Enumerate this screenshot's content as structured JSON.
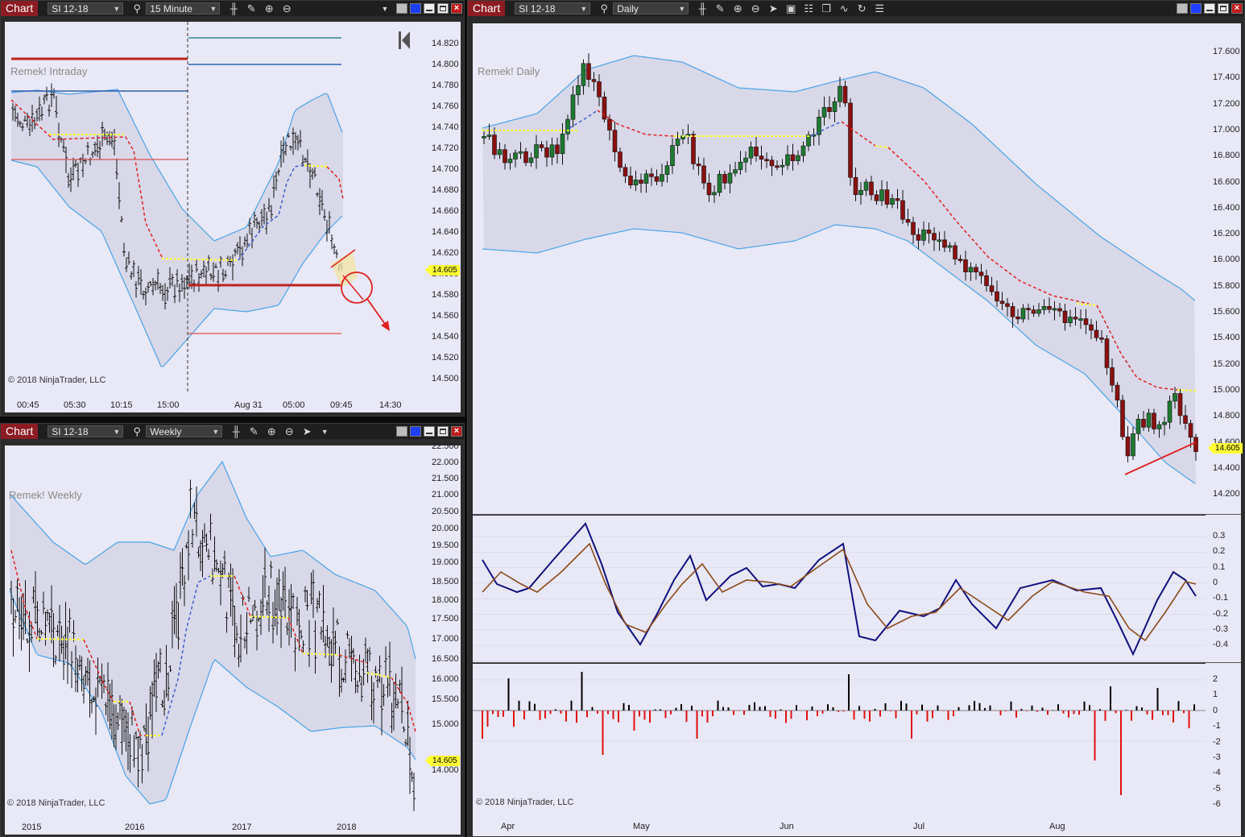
{
  "windows": {
    "intraday": {
      "tab": "Chart",
      "instrument": "SI 12-18",
      "interval": "15 Minute",
      "watermark": "Remek! Intraday",
      "copyright": "© 2018 NinjaTrader, LLC",
      "price_tag": "14.605",
      "y_ticks": [
        "14.820",
        "14.800",
        "14.780",
        "14.760",
        "14.740",
        "14.720",
        "14.700",
        "14.680",
        "14.660",
        "14.640",
        "14.620",
        "14.600",
        "14.580",
        "14.560",
        "14.540",
        "14.520",
        "14.500"
      ],
      "x_ticks": [
        "00:45",
        "05:30",
        "10:15",
        "15:00",
        "Aug 31",
        "05:00",
        "09:45",
        "14:30"
      ]
    },
    "weekly": {
      "tab": "Chart",
      "instrument": "SI 12-18",
      "interval": "Weekly",
      "watermark": "Remek! Weekly",
      "copyright": "© 2018 NinjaTrader, LLC",
      "price_tag": "14.605",
      "y_ticks": [
        "22.500",
        "22.000",
        "21.500",
        "21.000",
        "20.500",
        "20.000",
        "19.500",
        "19.000",
        "18.500",
        "18.000",
        "17.500",
        "17.000",
        "16.500",
        "16.000",
        "15.500",
        "15.000",
        "14.000"
      ],
      "x_ticks": [
        "2015",
        "2016",
        "2017",
        "2018"
      ]
    },
    "daily": {
      "tab": "Chart",
      "instrument": "SI 12-18",
      "interval": "Daily",
      "watermark": "Remek! Daily",
      "copyright": "© 2018 NinjaTrader, LLC",
      "price_tag": "14.605",
      "y_ticks": [
        "17.600",
        "17.400",
        "17.200",
        "17.000",
        "16.800",
        "16.600",
        "16.400",
        "16.200",
        "16.000",
        "15.800",
        "15.600",
        "15.400",
        "15.200",
        "15.000",
        "14.800",
        "14.600",
        "14.400",
        "14.200"
      ],
      "osc_ticks": [
        "0.3",
        "0.2",
        "0.1",
        "0",
        "-0.1",
        "-0.2",
        "-0.3",
        "-0.4"
      ],
      "hist_ticks": [
        "2",
        "1",
        "0",
        "-1",
        "-2",
        "-3",
        "-4",
        "-5",
        "-6"
      ],
      "x_ticks": [
        "Apr",
        "May",
        "Jun",
        "Jul",
        "Aug"
      ]
    }
  },
  "icons": [
    "search-icon",
    "bar-style-icon",
    "pencil-icon",
    "zoom-in-icon",
    "zoom-out-icon",
    "pointer-icon",
    "dropdown-arrow-icon",
    "data-box-icon",
    "properties-icon",
    "strategies-icon",
    "indicators-icon",
    "reload-icon",
    "menu-icon",
    "scroll-end-icon"
  ],
  "colors": {
    "tab": "#8c1c22",
    "plot_bg": "#e8e8f6",
    "up_candle": "#1e7a32",
    "down_candle": "#8a1010",
    "band": "#4aa3e8",
    "trend_down": "#e02020",
    "trend_up": "#4060d0",
    "neutral": "#ffff33",
    "osc_fast": "#101080",
    "osc_slow": "#8a4a1a"
  }
}
